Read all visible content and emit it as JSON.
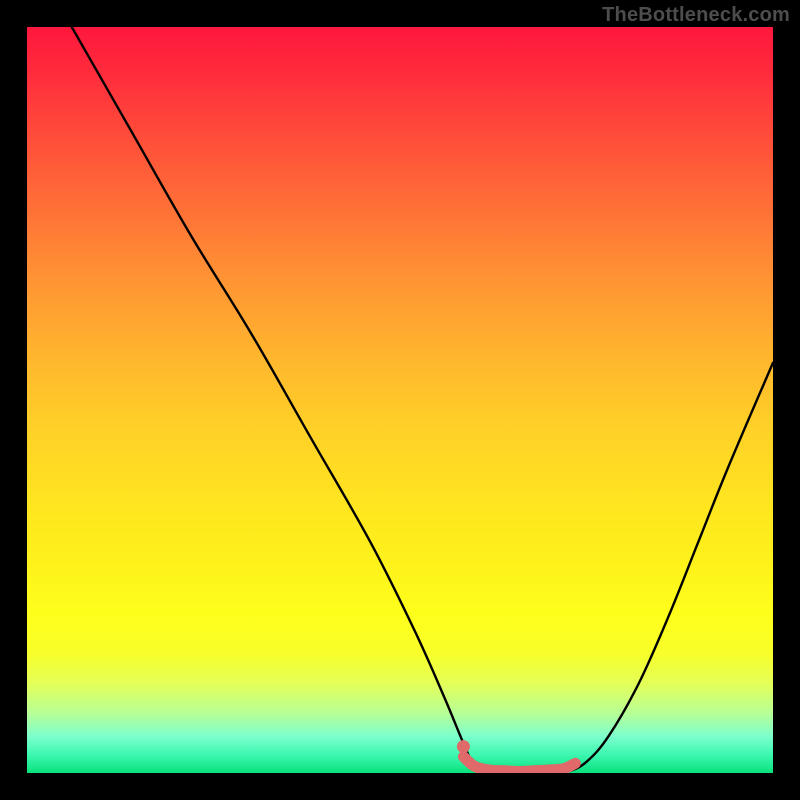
{
  "watermark": "TheBottleneck.com",
  "chart_data": {
    "type": "line",
    "title": "",
    "xlabel": "",
    "ylabel": "",
    "xlim": [
      0,
      100
    ],
    "ylim": [
      0,
      100
    ],
    "series": [
      {
        "name": "curve",
        "points": [
          [
            6,
            100
          ],
          [
            14,
            86
          ],
          [
            22,
            72
          ],
          [
            30,
            59
          ],
          [
            38,
            45
          ],
          [
            46,
            31
          ],
          [
            52,
            19
          ],
          [
            56,
            10
          ],
          [
            58.5,
            4
          ],
          [
            60,
            1
          ],
          [
            62,
            0.2
          ],
          [
            66,
            0
          ],
          [
            70,
            0
          ],
          [
            72.5,
            0.2
          ],
          [
            75,
            1.5
          ],
          [
            78,
            5
          ],
          [
            82,
            12
          ],
          [
            86,
            21
          ],
          [
            90,
            31
          ],
          [
            94,
            41
          ],
          [
            100,
            55
          ]
        ]
      },
      {
        "name": "highlight",
        "points": [
          [
            58.5,
            2.2
          ],
          [
            60,
            0.9
          ],
          [
            62,
            0.4
          ],
          [
            64,
            0.3
          ],
          [
            66,
            0.2
          ],
          [
            68,
            0.3
          ],
          [
            70,
            0.4
          ],
          [
            72,
            0.6
          ],
          [
            73.5,
            1.3
          ]
        ]
      }
    ],
    "gradient_stops": [
      {
        "pos": 0,
        "color": "#ff173d"
      },
      {
        "pos": 50,
        "color": "#ffd127"
      },
      {
        "pos": 80,
        "color": "#feff1b"
      },
      {
        "pos": 100,
        "color": "#09e27c"
      }
    ]
  }
}
